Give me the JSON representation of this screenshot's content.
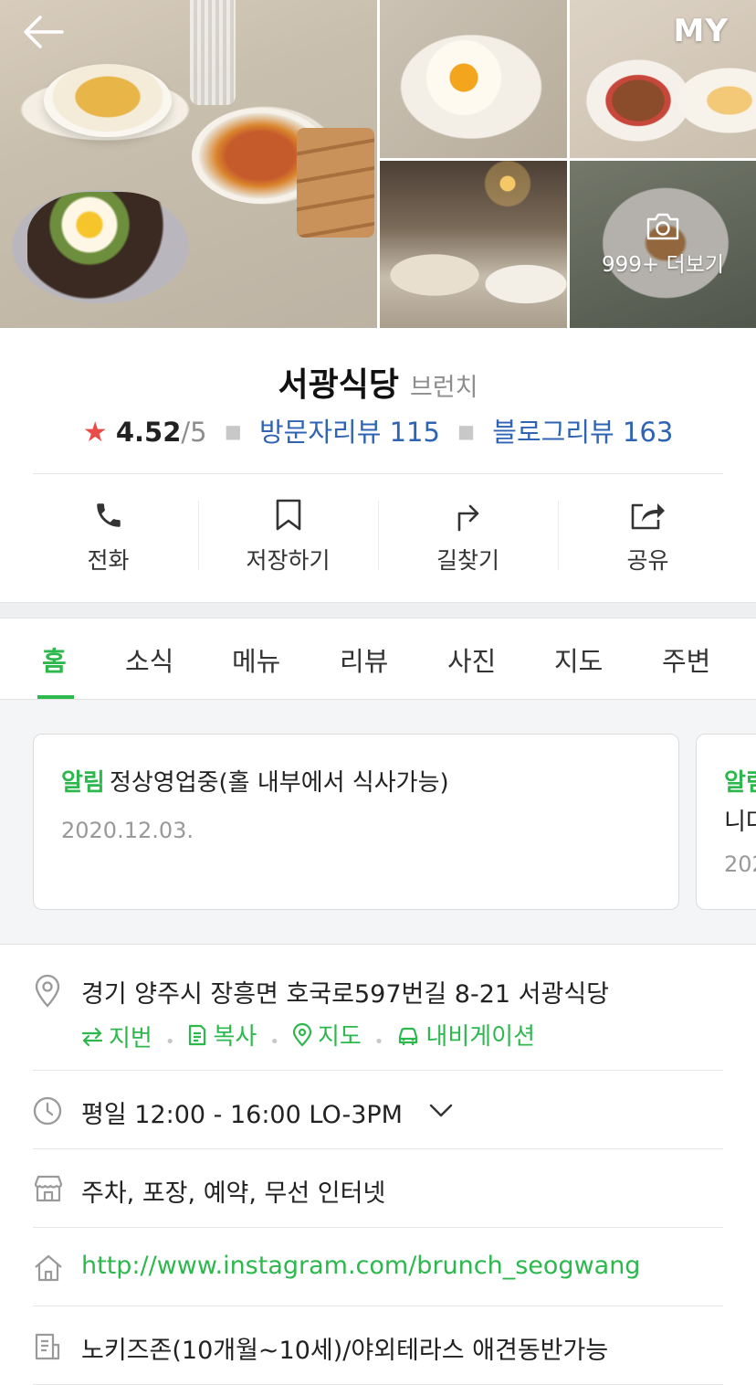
{
  "header": {
    "my_label": "MY",
    "more_photos_label": "999+ 더보기"
  },
  "place": {
    "name": "서광식당",
    "category": "브런치",
    "rating_score": "4.52",
    "rating_outof": "/5",
    "visitor_reviews_label": "방문자리뷰 115",
    "blog_reviews_label": "블로그리뷰 163"
  },
  "actions": [
    {
      "label": "전화",
      "icon": "phone-icon"
    },
    {
      "label": "저장하기",
      "icon": "bookmark-icon"
    },
    {
      "label": "길찾기",
      "icon": "directions-icon"
    },
    {
      "label": "공유",
      "icon": "share-icon"
    }
  ],
  "tabs": [
    "홈",
    "소식",
    "메뉴",
    "리뷰",
    "사진",
    "지도",
    "주변"
  ],
  "active_tab": "홈",
  "notices": [
    {
      "tag": "알림",
      "message": "정상영업중(홀 내부에서 식사가능)",
      "date": "2020.12.03."
    },
    {
      "tag": "알림",
      "message": "니다",
      "date": "202"
    }
  ],
  "info": {
    "address": "경기 양주시 장흥면 호국로597번길 8-21 서광식당",
    "address_links": [
      "지번",
      "복사",
      "지도",
      "내비게이션"
    ],
    "hours": "평일 12:00 - 16:00 LO-3PM",
    "amenities": "주차, 포장, 예약, 무선 인터넷",
    "website": "http://www.instagram.com/brunch_seogwang",
    "description": "노키즈존(10개월~10세)/야외테라스 애견동반가능"
  },
  "colors": {
    "accent_green": "#2db84e",
    "link_blue": "#2f64b5",
    "star_red": "#e84e47"
  }
}
